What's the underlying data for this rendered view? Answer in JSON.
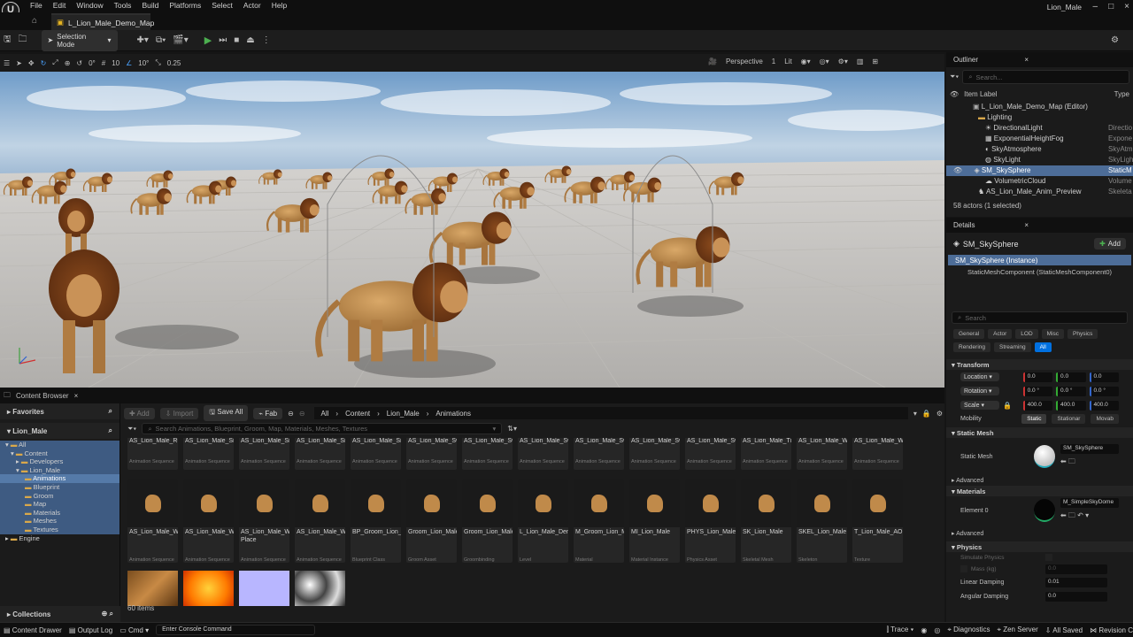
{
  "menu": {
    "items": [
      "File",
      "Edit",
      "Window",
      "Tools",
      "Build",
      "Platforms",
      "Select",
      "Actor",
      "Help"
    ],
    "user": "Lion_Male"
  },
  "tab": {
    "map": "L_Lion_Male_Demo_Map"
  },
  "toolbar": {
    "selection_mode": "Selection Mode"
  },
  "viewport_toolbar": {
    "rot_val": "0°",
    "grid": "10",
    "angle": "10°",
    "scale": "0.25",
    "perspective": "Perspective",
    "cam": "1",
    "lit": "Lit"
  },
  "outliner": {
    "title": "Outliner",
    "search_placeholder": "Search...",
    "col_label": "Item Label",
    "col_type": "Type",
    "items": [
      {
        "label": "L_Lion_Male_Demo_Map (Editor)",
        "type": ""
      },
      {
        "label": "Lighting",
        "type": ""
      },
      {
        "label": "DirectionalLight",
        "type": "Directio"
      },
      {
        "label": "ExponentialHeightFog",
        "type": "Expone"
      },
      {
        "label": "SkyAtmosphere",
        "type": "SkyAtm"
      },
      {
        "label": "SkyLight",
        "type": "SkyLigh"
      },
      {
        "label": "SM_SkySphere",
        "type": "StaticM"
      },
      {
        "label": "VolumetricCloud",
        "type": "Volume"
      },
      {
        "label": "AS_Lion_Male_Anim_Preview",
        "type": "Skeleta"
      }
    ],
    "status": "58 actors (1 selected)"
  },
  "details": {
    "title": "Details",
    "object": "SM_SkySphere",
    "add": "Add",
    "instance": "SM_SkySphere (Instance)",
    "component": "StaticMeshComponent (StaticMeshComponent0)",
    "search_placeholder": "Search",
    "filters_row1": [
      "General",
      "Actor",
      "LOD",
      "Misc",
      "Physics"
    ],
    "filters_row2": [
      "Rendering",
      "Streaming",
      "All"
    ],
    "transform": "Transform",
    "location": "Location",
    "rotation": "Rotation",
    "scale": "Scale",
    "loc_vals": [
      "0.0",
      "0.0",
      "0.0"
    ],
    "rot_vals": [
      "0.0 °",
      "0.0 °",
      "0.0 °"
    ],
    "scale_vals": [
      "400.0",
      "400.0",
      "400.0"
    ],
    "mobility": "Mobility",
    "mob_opts": [
      "Static",
      "Stationar",
      "Movab"
    ],
    "static_mesh_sect": "Static Mesh",
    "static_mesh_label": "Static Mesh",
    "static_mesh_val": "SM_SkySphere",
    "advanced": "Advanced",
    "materials": "Materials",
    "element0": "Element 0",
    "element0_val": "M_SimpleSkyDome",
    "physics": "Physics",
    "simulate": "Simulate Physics",
    "mass": "Mass (kg)",
    "mass_val": "0.0",
    "linear_damping": "Linear Damping",
    "linear_val": "0.01",
    "angular_damping": "Angular Damping",
    "angular_val": "0.0"
  },
  "content_browser": {
    "title": "Content Browser",
    "add": "Add",
    "import": "Import",
    "save_all": "Save All",
    "fab": "Fab",
    "path": [
      "All",
      "Content",
      "Lion_Male",
      "Animations"
    ],
    "search_placeholder": "Search Animations, Blueprint, Groom, Map, Materials, Meshes, Textures",
    "favorites": "Favorites",
    "project": "Lion_Male",
    "folders": [
      "All",
      "Content",
      "Developers",
      "Lion_Male",
      "Animations",
      "Blueprint",
      "Groom",
      "Map",
      "Materials",
      "Meshes",
      "Textures",
      "Engine"
    ],
    "collections": "Collections",
    "count": "60 items",
    "row1": [
      {
        "name": "AS_Lion_Male_Run_Right_RM",
        "type": "Animation Sequence"
      },
      {
        "name": "AS_Lion_Male_Sit_Side_way",
        "type": "Animation Sequence"
      },
      {
        "name": "AS_Lion_Male_Sit_Side_way_2",
        "type": "Animation Sequence"
      },
      {
        "name": "AS_Lion_Male_Sit_UP",
        "type": "Animation Sequence"
      },
      {
        "name": "AS_Lion_Male_Sitting",
        "type": "Animation Sequence"
      },
      {
        "name": "AS_Lion_Male_Swim_All_RM",
        "type": "Animation Sequence"
      },
      {
        "name": "AS_Lion_Male_Swim_Backward",
        "type": "Animation Sequence"
      },
      {
        "name": "AS_Lion_Male_Swim_Floating",
        "type": "Animation Sequence"
      },
      {
        "name": "AS_Lion_Male_Swim_Forward_2",
        "type": "Animation Sequence"
      },
      {
        "name": "AS_Lion_Male_Swim_Left_RM",
        "type": "Animation Sequence"
      },
      {
        "name": "AS_Lion_Male_Swim_Right_RM",
        "type": "Animation Sequence"
      },
      {
        "name": "AS_Lion_Male_Turn_Right_Left_Blend_Space_...",
        "type": "Animation Sequence"
      },
      {
        "name": "AS_Lion_Male_Walk_Backward_Inplace",
        "type": "Animation Sequence"
      },
      {
        "name": "AS_Lion_Male_Walk_Forward_Inplace",
        "type": "Animation Sequence"
      }
    ],
    "row2": [
      {
        "name": "AS_Lion_Male_Walk_Left_Inplace",
        "type": "Animation Sequence"
      },
      {
        "name": "AS_Lion_Male_Walk_Left_RM",
        "type": "Animation Sequence"
      },
      {
        "name": "AS_Lion_Male_Walk_Right_In Place",
        "type": "Animation Sequence"
      },
      {
        "name": "AS_Lion_Male_Walk_Right_RM",
        "type": "Animation Sequence"
      },
      {
        "name": "BP_Groom_Lion_Male_Preview",
        "type": "Blueprint Class"
      },
      {
        "name": "Groom_Lion_Male",
        "type": "Groom Asset"
      },
      {
        "name": "Groom_Lion_Male_SK_Lion_Male_SK_Lion...",
        "type": "Groombinding"
      },
      {
        "name": "L_Lion_Male_Demo_Map",
        "type": "Level"
      },
      {
        "name": "M_Groom_Lion_Male",
        "type": "Material"
      },
      {
        "name": "MI_Lion_Male",
        "type": "Material Instance"
      },
      {
        "name": "PHYS_Lion_Male",
        "type": "Physics Asset"
      },
      {
        "name": "SK_Lion_Male",
        "type": "Skeletal Mesh"
      },
      {
        "name": "SKEL_Lion_Male",
        "type": "Skeleton"
      },
      {
        "name": "T_Lion_Male_AO",
        "type": "Texture"
      }
    ]
  },
  "statusbar": {
    "drawer": "Content Drawer",
    "output": "Output Log",
    "cmd": "Cmd",
    "console_placeholder": "Enter Console Command",
    "trace": "Trace",
    "diagnostics": "Diagnostics",
    "zen": "Zen Server",
    "saved": "All Saved",
    "revision": "Revision C"
  }
}
